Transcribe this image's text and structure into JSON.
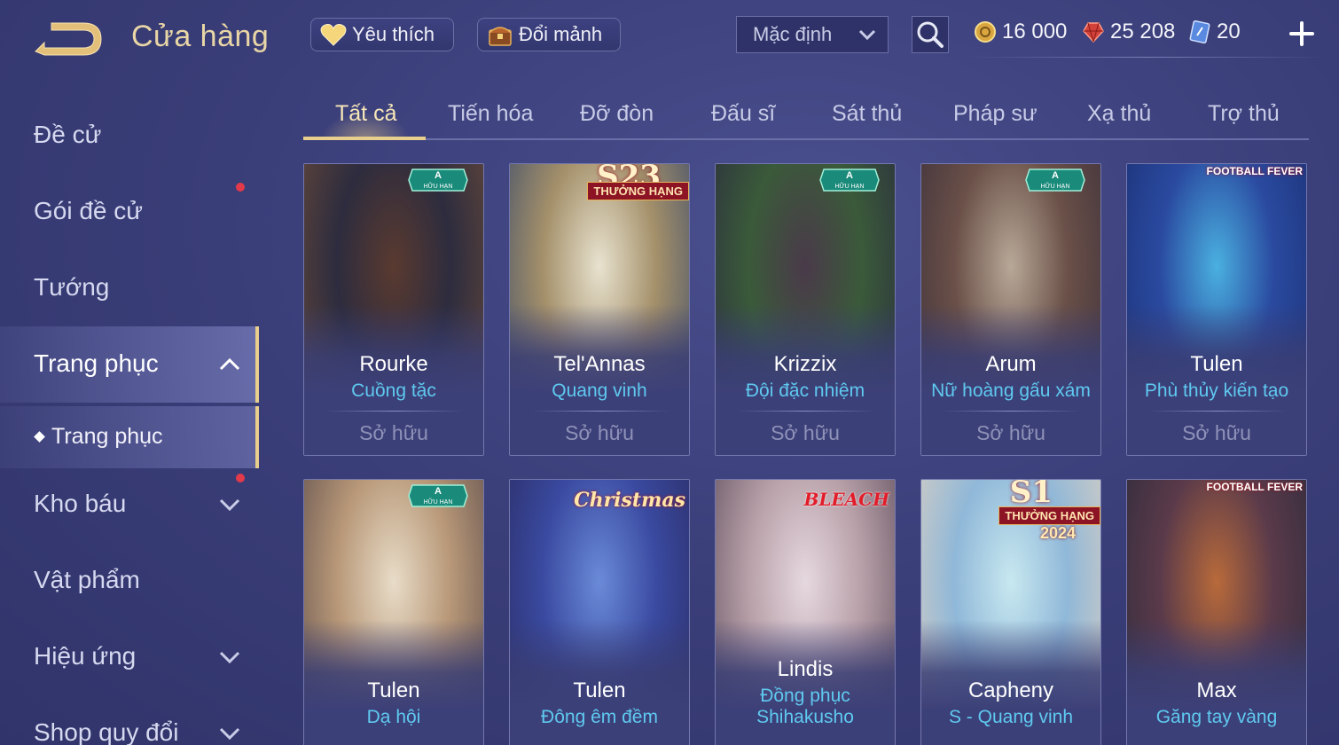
{
  "header": {
    "title": "Cửa hàng",
    "favorites_label": "Yêu thích",
    "shard_exchange_label": "Đổi mảnh",
    "sort_value": "Mặc định"
  },
  "currencies": {
    "gold": "16 000",
    "ruby": "25 208",
    "voucher": "20"
  },
  "sidebar": {
    "items": [
      {
        "label": "Đề cử"
      },
      {
        "label": "Gói đề cử"
      },
      {
        "label": "Tướng"
      },
      {
        "label": "Trang phục"
      },
      {
        "label": "Kho báu"
      },
      {
        "label": "Vật phẩm"
      },
      {
        "label": "Hiệu ứng"
      },
      {
        "label": "Shop quy đổi"
      }
    ],
    "sub_item": "Trang phục"
  },
  "tabs": [
    "Tất cả",
    "Tiến hóa",
    "Đỡ đòn",
    "Đấu sĩ",
    "Sát thủ",
    "Pháp sư",
    "Xạ thủ",
    "Trợ thủ"
  ],
  "cards": [
    {
      "hero": "Rourke",
      "skin": "Cuồng tặc",
      "status": "Sở hữu",
      "badge": "A",
      "badge_sub": "HỮU HẠN",
      "colors": [
        "#5a3a30",
        "#2d2c3e",
        "#6b4b3a"
      ]
    },
    {
      "hero": "Tel'Annas",
      "skin": "Quang vinh",
      "status": "Sở hữu",
      "badge": "S23",
      "badge_sub": "THƯỞNG HẠNG",
      "colors": [
        "#e8e2cf",
        "#a4906a",
        "#3a4a6a"
      ]
    },
    {
      "hero": "Krizzix",
      "skin": "Đội đặc nhiệm",
      "status": "Sở hữu",
      "badge": "A",
      "badge_sub": "HỮU HẠN",
      "colors": [
        "#4a3a4a",
        "#3a5a3a",
        "#2a2a3e"
      ]
    },
    {
      "hero": "Arum",
      "skin": "Nữ hoàng gấu xám",
      "status": "Sở hữu",
      "badge": "A",
      "badge_sub": "HỮU HẠN",
      "colors": [
        "#b8a898",
        "#6a5048",
        "#3a2e3a"
      ]
    },
    {
      "hero": "Tulen",
      "skin": "Phù thủy kiến tạo",
      "status": "Sở hữu",
      "badge": "FOOTBALL FEVER",
      "badge_sub": "",
      "colors": [
        "#4ab0e0",
        "#2a4aa0",
        "#1a2e70"
      ]
    },
    {
      "hero": "Tulen",
      "skin": "Dạ hội",
      "status": "",
      "badge": "A",
      "badge_sub": "HỮU HẠN",
      "colors": [
        "#e8dcc8",
        "#b89878",
        "#5a4a4a"
      ]
    },
    {
      "hero": "Tulen",
      "skin": "Đông êm đềm",
      "status": "",
      "badge": "Christmas",
      "badge_sub": "",
      "colors": [
        "#6a8ad8",
        "#3a4aa0",
        "#2a2a60"
      ]
    },
    {
      "hero": "Lindis",
      "skin": "Đồng phục Shihakusho",
      "status": "",
      "badge": "BLEACH",
      "badge_sub": "",
      "colors": [
        "#e6d8e0",
        "#b8a0a8",
        "#5a4a5a"
      ]
    },
    {
      "hero": "Capheny",
      "skin": "S - Quang vinh",
      "status": "",
      "badge": "S1",
      "badge_sub": "THƯỞNG HẠNG",
      "badge_year": "2024",
      "colors": [
        "#c8e8f0",
        "#90b8d8",
        "#e0d0c0"
      ]
    },
    {
      "hero": "Max",
      "skin": "Găng tay vàng",
      "status": "",
      "badge": "FOOTBALL FEVER",
      "badge_sub": "",
      "colors": [
        "#b86a3a",
        "#5a3a4a",
        "#2a2a3a"
      ]
    }
  ],
  "colors": {
    "accent_gold": "#e8cf8e",
    "skin_blue": "#5fc9f0",
    "notify_red": "#e23a4a",
    "background": "#3b3f7a"
  }
}
